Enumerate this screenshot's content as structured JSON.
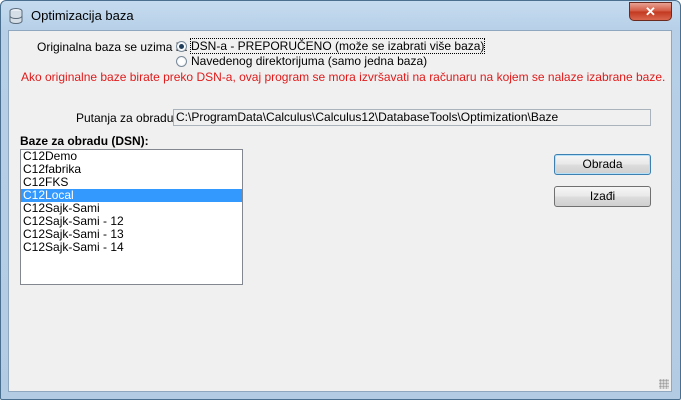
{
  "window": {
    "title": "Optimizacija baza",
    "close_symbol": "✕"
  },
  "source": {
    "label": "Originalna baza se uzima iz:",
    "options": [
      {
        "label": "DSN-a - PREPORUČENO (može se izabrati više baza)",
        "checked": true
      },
      {
        "label": "Navedenog direktorijuma (samo jedna baza)",
        "checked": false
      }
    ],
    "warning": "Ako originalne baze birate preko DSN-a, ovaj program se mora izvršavati na računaru na kojem se nalaze izabrane baze."
  },
  "path": {
    "label": "Putanja za obradu:",
    "value": "C:\\ProgramData\\Calculus\\Calculus12\\DatabaseTools\\Optimization\\Baze"
  },
  "dsn": {
    "label": "Baze za obradu (DSN):",
    "items": [
      "C12Demo",
      "C12fabrika",
      "C12FKS",
      "C12Local",
      "C12Sajk-Sami",
      "C12Sajk-Sami - 12",
      "C12Sajk-Sami - 13",
      "C12Sajk-Sami - 14"
    ],
    "selected_index": 3
  },
  "buttons": {
    "process": "Obrada",
    "exit": "Izađi"
  },
  "colors": {
    "warning": "#e01a1a",
    "selection": "#3399ff"
  }
}
